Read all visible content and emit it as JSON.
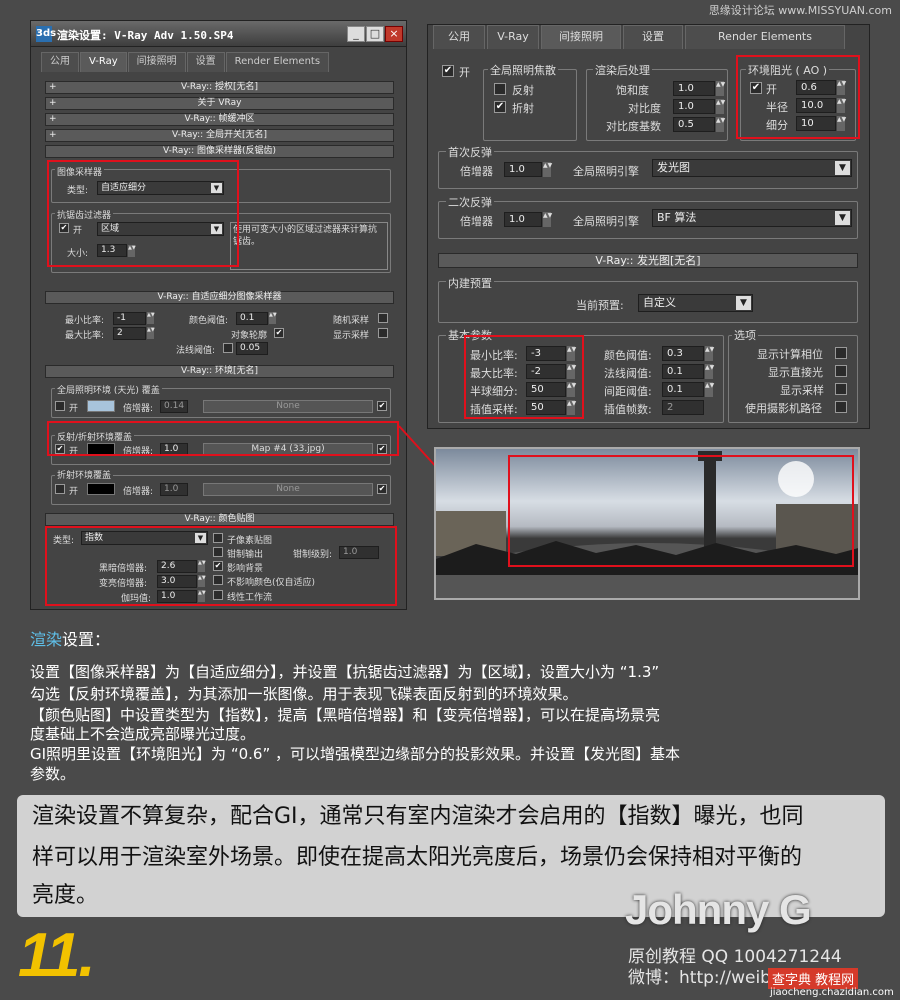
{
  "watermark_top": "思缘设计论坛 www.MISSYUAN.com",
  "dialog": {
    "title": "渲染设置: V-Ray Adv 1.50.SP4",
    "logo": "3ds",
    "min_btn": "_",
    "max_btn": "□",
    "close_btn": "×",
    "tabs": [
      "公用",
      "V-Ray",
      "间接照明",
      "设置",
      "Render Elements"
    ],
    "rollouts": [
      "V-Ray:: 授权[无名]",
      "关于 VRay",
      "V-Ray:: 帧缓冲区",
      "V-Ray:: 全局开关[无名]",
      "V-Ray:: 图像采样器(反锯齿)"
    ],
    "rollout_sign": "+",
    "img_sampler": {
      "group": "图像采样器",
      "type_label": "类型:",
      "type_value": "自适应细分"
    },
    "aa_filter": {
      "group": "抗锯齿过滤器",
      "on": "开",
      "filter": "区域",
      "size_label": "大小:",
      "size_value": "1.3",
      "desc": "使用可变大小的区域过滤器来计算抗锯齿。"
    },
    "adaptive": {
      "title": "V-Ray:: 自适应细分图像采样器",
      "min_label": "最小比率:",
      "min": "-1",
      "max_label": "最大比率:",
      "max": "2",
      "clr_label": "颜色阈值:",
      "clr": "0.1",
      "obj_label": "对象轮廓",
      "normal_label": "法线阈值:",
      "normal": "0.05",
      "rand_label": "随机采样",
      "show_label": "显示采样"
    },
    "env": {
      "title": "V-Ray:: 环境[无名]",
      "gi_group": "全局照明环境 (天光) 覆盖",
      "on": "开",
      "mult": "倍增器:",
      "gi_mult": "0.14",
      "none": "None",
      "refl_group": "反射/折射环境覆盖",
      "refl_mult": "1.0",
      "refl_map": "Map #4 (33.jpg)",
      "refr_group": "折射环境覆盖",
      "refr_mult": "1.0"
    },
    "color_map": {
      "title": "V-Ray:: 颜色贴图",
      "type_label": "类型:",
      "type": "指数",
      "dark_label": "黑暗倍增器:",
      "dark": "2.6",
      "bright_label": "变亮倍增器:",
      "bright": "3.0",
      "gamma_label": "伽玛值:",
      "gamma": "1.0",
      "opts": [
        "子像素贴图",
        "钳制输出",
        "影响背景",
        "不影响颜色(仅自适应)",
        "线性工作流"
      ],
      "clamp_label": "钳制级别:",
      "clamp": "1.0"
    }
  },
  "gi_panel": {
    "tabs": [
      "公用",
      "V-Ray",
      "间接照明",
      "设置",
      "Render Elements"
    ],
    "on": "开",
    "caustics": {
      "group": "全局照明焦散",
      "reflect": "反射",
      "refract": "折射"
    },
    "post": {
      "group": "渲染后处理",
      "sat_label": "饱和度",
      "sat": "1.0",
      "con_label": "对比度",
      "con": "1.0",
      "base_label": "对比度基数",
      "base": "0.5"
    },
    "ao": {
      "group": "环境阻光 ( AO )",
      "on": "开",
      "amount": "0.6",
      "radius_label": "半径",
      "radius": "10.0",
      "sub_label": "细分",
      "sub": "10"
    },
    "primary": {
      "group": "首次反弹",
      "mult_label": "倍增器",
      "mult": "1.0",
      "engine_label": "全局照明引擎",
      "engine": "发光图"
    },
    "secondary": {
      "group": "二次反弹",
      "mult_label": "倍增器",
      "mult": "1.0",
      "engine_label": "全局照明引擎",
      "engine": "BF 算法"
    },
    "irr_title": "V-Ray:: 发光图[无名]",
    "preset": {
      "group": "内建预置",
      "label": "当前预置:",
      "value": "自定义"
    },
    "basic": {
      "group": "基本参数",
      "min_label": "最小比率:",
      "min": "-3",
      "max_label": "最大比率:",
      "max": "-2",
      "hsph_label": "半球细分:",
      "hsph": "50",
      "interp_label": "插值采样:",
      "interp": "50",
      "clr_label": "颜色阈值:",
      "clr": "0.3",
      "nrm_label": "法线阈值:",
      "nrm": "0.1",
      "dist_label": "间距阈值:",
      "dist": "0.1",
      "frames_label": "插值帧数:",
      "frames": "2"
    },
    "options": {
      "group": "选项",
      "items": [
        "显示计算相位",
        "显示直接光",
        "显示采样",
        "使用摄影机路径"
      ]
    }
  },
  "text": {
    "section_hl": "渲染",
    "section_rest": "设置：",
    "paras": [
      "设置【图像采样器】为【自适应细分】，并设置【抗锯齿过滤器】为【区域】，设置大小为 “1.3”",
      "勾选【反射环境覆盖】，为其添加一张图像。用于表现飞碟表面反射到的环境效果。",
      "【颜色贴图】中设置类型为【指数】，提高【黑暗倍增器】和【变亮倍增器】，可以在提高场景亮",
      "度基础上不会造成亮部曝光过度。",
      "GI照明里设置【环境阻光】为 “0.6” ，可以增强模型边缘部分的投影效果。并设置【发光图】基本",
      "参数。"
    ],
    "box": [
      "渲染设置不算复杂，配合GI，通常只有室内渲染才会启用的【指数】曝光，也同",
      "样可以用于渲染室外场景。即使在提高太阳光亮度后，场景仍会保持相对平衡的",
      "亮度。"
    ]
  },
  "step_number": "11.",
  "signature": {
    "name": "Johnny G",
    "line1": "原创教程  QQ 1004271244",
    "line2": "微博：http://weib"
  },
  "watermark_bottom": {
    "brand": "查字典 教程网",
    "url": "jiaocheng.chazidian.com"
  },
  "colors": {
    "accent_red": "#e0101c",
    "step_yellow": "#f2c200",
    "highlight_blue": "#5fbfe8"
  }
}
